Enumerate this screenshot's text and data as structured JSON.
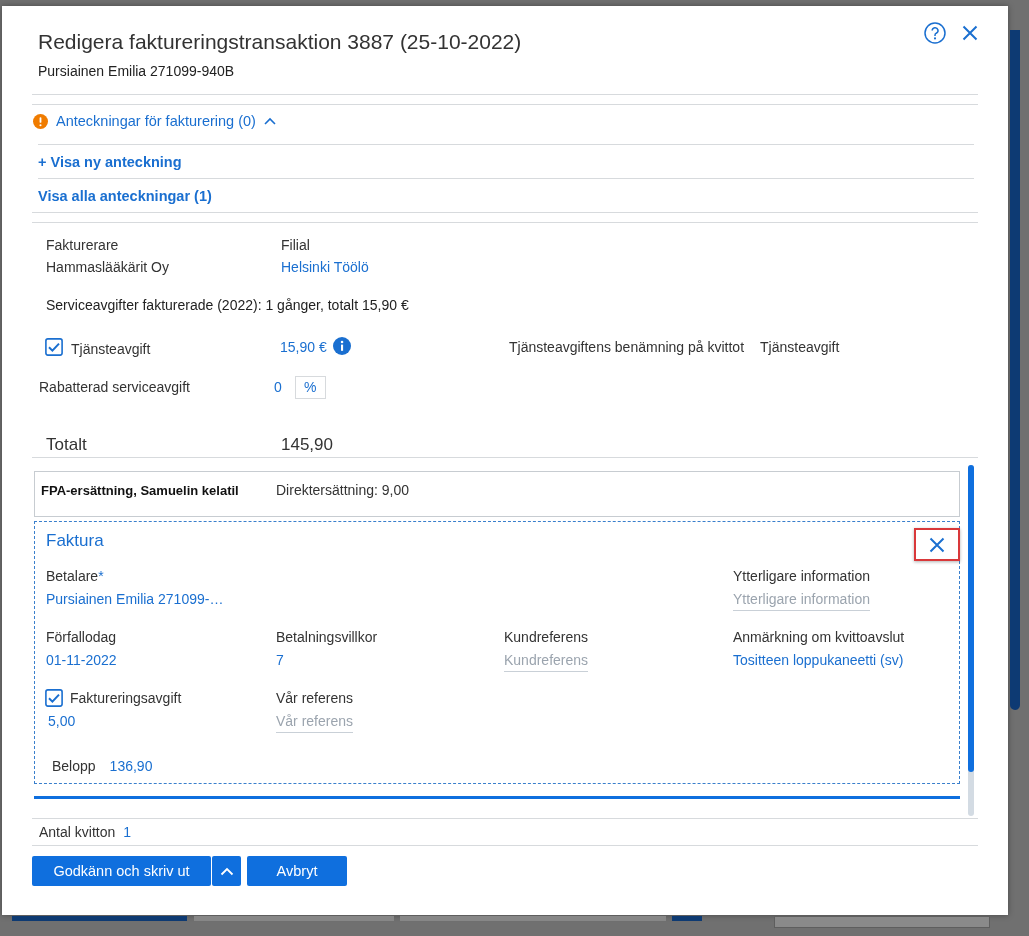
{
  "dialog": {
    "title": "Redigera faktureringstransaktion 3887 (25-10-2022)",
    "subtitle": "Pursiainen Emilia 271099-940B"
  },
  "notes": {
    "heading": "Anteckningar för fakturering (0)",
    "expanded": true,
    "links": [
      "+ Visa ny anteckning",
      "Visa alla anteckningar (1)"
    ]
  },
  "details": {
    "fields": [
      {
        "label": "Fakturerare",
        "value": "Hammaslääkärit Oy",
        "kind": "text"
      },
      {
        "label": "Filial",
        "value": "Helsinki Töölö",
        "kind": "link"
      }
    ],
    "summary": "Serviceavgifter fakturerade (2022): 1 gånger, totalt 15,90 €",
    "service_fee": {
      "label": "Tjänsteavgift",
      "checked": true,
      "amount": "15,90 €",
      "receipt_label": "Tjänsteavgiftens benämning på kvittot",
      "receipt_value": "Tjänsteavgift"
    },
    "discount": {
      "label": "Rabatterad serviceavgift",
      "value": "0",
      "unit": "%"
    },
    "total": {
      "label": "Totalt",
      "value": "145,90"
    }
  },
  "payments": [
    {
      "kind": "reimbursement",
      "title": "FPA-ersättning, Samuelin kelatil",
      "detail": "Direktersättning: 9,00"
    },
    {
      "kind": "invoice",
      "title": "Faktura",
      "close_highlighted": true,
      "rows": [
        [
          {
            "kind": "value",
            "label": "Betalare",
            "required_mark": "*",
            "value": "Pursiainen Emilia 271099-…"
          },
          null,
          null,
          {
            "kind": "input",
            "label": "Ytterligare information",
            "placeholder": "Ytterligare information"
          }
        ],
        [
          {
            "kind": "value",
            "label": "Förfallodag",
            "value": "01-11-2022"
          },
          {
            "kind": "value",
            "label": "Betalningsvillkor",
            "value": "7"
          },
          {
            "kind": "input",
            "label": "Kundreferens",
            "placeholder": "Kundreferens"
          },
          {
            "kind": "value",
            "label": "Anmärkning om kvittoavslut",
            "value": "Tositteen loppukaneetti (sv)"
          }
        ],
        [
          {
            "kind": "checkbox",
            "label": "Faktureringsavgift",
            "checked": true,
            "value": "5,00"
          },
          {
            "kind": "input",
            "label": "Vår referens",
            "placeholder": "Vår referens"
          },
          null,
          null
        ]
      ],
      "amount": {
        "label": "Belopp",
        "value": "136,90"
      }
    }
  ],
  "receipts": {
    "label": "Antal kvitton",
    "value": "1"
  },
  "buttons": [
    {
      "label": "Godkänn och skriv ut",
      "kind": "split"
    },
    {
      "label": "Avbryt",
      "kind": "primary"
    }
  ]
}
